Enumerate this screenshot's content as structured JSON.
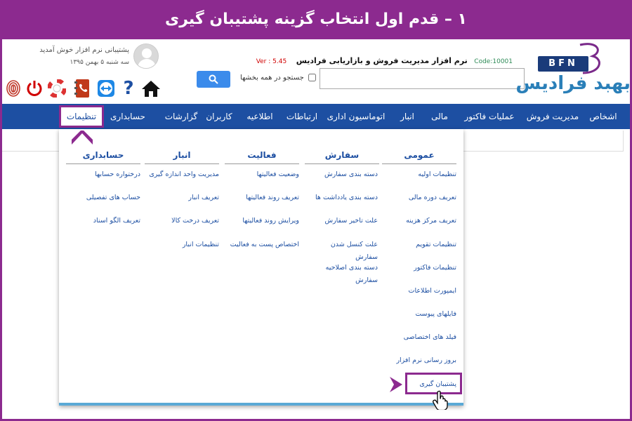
{
  "banner": {
    "text": "١ – قدم اول انتخاب گزینه پشتیبان گیری"
  },
  "user": {
    "welcome": "پشتیبانی نرم افزار خوش آمدید",
    "date": "سه شنبه ۵ بهمن ۱۳۹۵"
  },
  "header": {
    "code": "Code:10001",
    "app_name": "نرم افزار مدیریت فروش و بازاریابی فرادیس",
    "version": "Ver : 5.45"
  },
  "search": {
    "checkbox_label": "جستجو در همه بخشها",
    "value": ""
  },
  "logo": {
    "badge": "BFN",
    "name": "بهبد فرادیس"
  },
  "toolbar_icons": [
    "fingerprint-icon",
    "power-icon",
    "lifebuoy-icon",
    "phone-book-icon",
    "teamviewer-icon",
    "help-icon",
    "home-icon"
  ],
  "nav": {
    "items": [
      "اشخاص",
      "مدیریت فروش",
      "عملیات فاکتور",
      "مالی",
      "انبار",
      "اتوماسیون اداری",
      "ارتباطات",
      "اطلاعیه",
      "کاربران",
      "گزارشات",
      "حسابداری"
    ],
    "active": "تنظیمات"
  },
  "menu": {
    "columns": [
      {
        "title": "عمومی",
        "items": [
          "تنظیمات اولیه",
          "تعریف دوره مالی",
          "تعریف مرکز هزینه",
          "تنظیمات تقویم",
          "تنظیمات فاکتور",
          "ایمپورت اطلاعات",
          "فایلهای پیوست",
          "فیلد های اختصاصی",
          "بروز رسانی نرم افزار",
          "پشتیبان گیری"
        ]
      },
      {
        "title": "سفارش",
        "items": [
          "دسته بندی سفارش",
          "دسته بندی یادداشت ها",
          "علت تاخیر سفارش",
          "علت کنسل شدن",
          "سفارش",
          "دسته بندی اصلاحیه",
          "سفارش"
        ]
      },
      {
        "title": "فعالیت",
        "items": [
          "وضعیت فعالیتها",
          "تعریف روند فعالیتها",
          "ویرایش روند فعالیتها",
          "اختصاص پست به فعالیت"
        ]
      },
      {
        "title": "انبار",
        "items": [
          "مدیریت واحد اندازه گیری",
          "تعریف انبار",
          "تعریف درخت کالا",
          "تنظیمات انبار"
        ]
      },
      {
        "title": "حسابداری",
        "items": [
          "درختواره حسابها",
          "حساب های تفصیلی",
          "تعریف الگو اسناد"
        ]
      }
    ]
  },
  "colors": {
    "banner": "#8c2a8f",
    "nav": "#1d4fa2",
    "highlight": "#8c2a8f"
  }
}
